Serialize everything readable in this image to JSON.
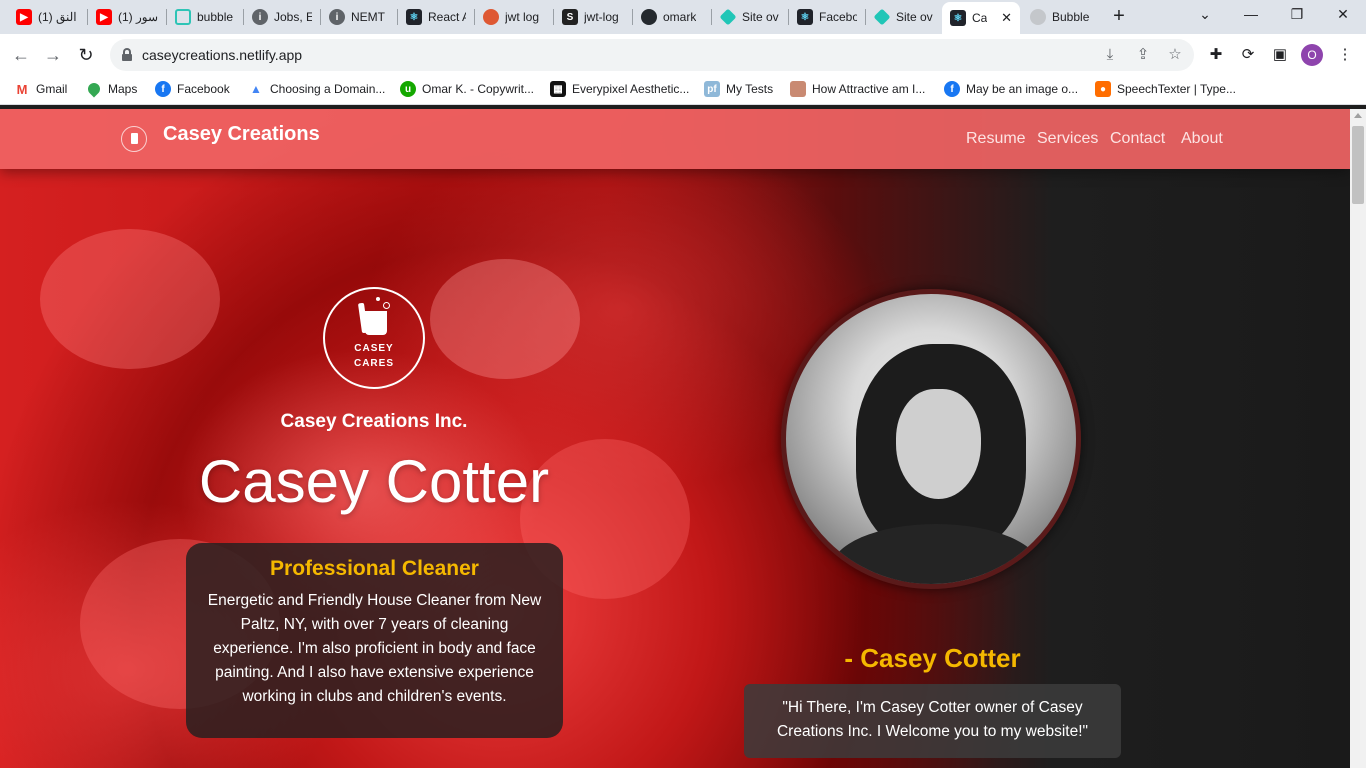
{
  "browser": {
    "tabs": [
      {
        "title": "(1) النق",
        "icon": "youtube-icon",
        "color": "#ff0000"
      },
      {
        "title": "(1) سور",
        "icon": "youtube-icon",
        "color": "#ff0000"
      },
      {
        "title": "bubble",
        "icon": "bubble-icon",
        "color": "#2ec4b6"
      },
      {
        "title": "Jobs, E",
        "icon": "info-icon",
        "color": "#5f6368"
      },
      {
        "title": "NEMT ",
        "icon": "info-icon",
        "color": "#5f6368"
      },
      {
        "title": "React A",
        "icon": "react-icon",
        "color": "#20232a"
      },
      {
        "title": "jwt log",
        "icon": "duckduckgo-icon",
        "color": "#de5833"
      },
      {
        "title": "jwt-log",
        "icon": "s-icon",
        "color": "#222222"
      },
      {
        "title": "omark",
        "icon": "github-icon",
        "color": "#24292e"
      },
      {
        "title": "Site ov",
        "icon": "netlify-icon",
        "color": "#20c6b7"
      },
      {
        "title": "Facebo",
        "icon": "react-icon",
        "color": "#20232a"
      },
      {
        "title": "Site ov",
        "icon": "netlify-icon",
        "color": "#20c6b7"
      },
      {
        "title": "Ca",
        "icon": "react-icon",
        "color": "#20232a",
        "active": true
      },
      {
        "title": "Bubble",
        "icon": "globe-icon",
        "color": "#9aa0a6"
      }
    ],
    "new_tab_label": "+",
    "url": "caseycreations.netlify.app",
    "bookmarks": [
      {
        "label": "Gmail",
        "icon": "gmail-icon",
        "color": "#ea4335"
      },
      {
        "label": "Maps",
        "icon": "maps-icon",
        "color": "#34a853"
      },
      {
        "label": "Facebook",
        "icon": "facebook-icon",
        "color": "#1877f2"
      },
      {
        "label": "Choosing a Domain...",
        "icon": "domain-icon",
        "color": "#4285f4"
      },
      {
        "label": "Omar K. - Copywrit...",
        "icon": "upwork-icon",
        "color": "#14a800"
      },
      {
        "label": "Everypixel Aesthetic...",
        "icon": "everypixel-icon",
        "color": "#111111"
      },
      {
        "label": "My Tests",
        "icon": "pf-icon",
        "color": "#8fb8d8"
      },
      {
        "label": "How Attractive am I...",
        "icon": "face-icon",
        "color": "#c98a72"
      },
      {
        "label": "May be an image o...",
        "icon": "facebook-icon",
        "color": "#1877f2"
      },
      {
        "label": "SpeechTexter | Type...",
        "icon": "mic-icon",
        "color": "#ff6d00"
      }
    ],
    "profile_initial": "O"
  },
  "site": {
    "brand": "Casey Creations",
    "nav": [
      "Resume",
      "Services",
      "Contact",
      "About"
    ],
    "logo_line1": "CASEY",
    "logo_line2": "CARES",
    "company": "Casey Creations Inc.",
    "name": "Casey Cotter",
    "card_title": "Professional Cleaner",
    "card_text": "Energetic and Friendly House Cleaner from New Paltz, NY, with over 7 years of cleaning experience. I'm also proficient in body and face painting. And I also have extensive experience working in clubs and children's events.",
    "signoff": "- Casey Cotter",
    "quote": "\"Hi There, I'm Casey Cotter owner of Casey Creations Inc. I Welcome you to my website!\""
  },
  "colors": {
    "navbar": "#f06464",
    "accent_gold": "#f5b800"
  }
}
